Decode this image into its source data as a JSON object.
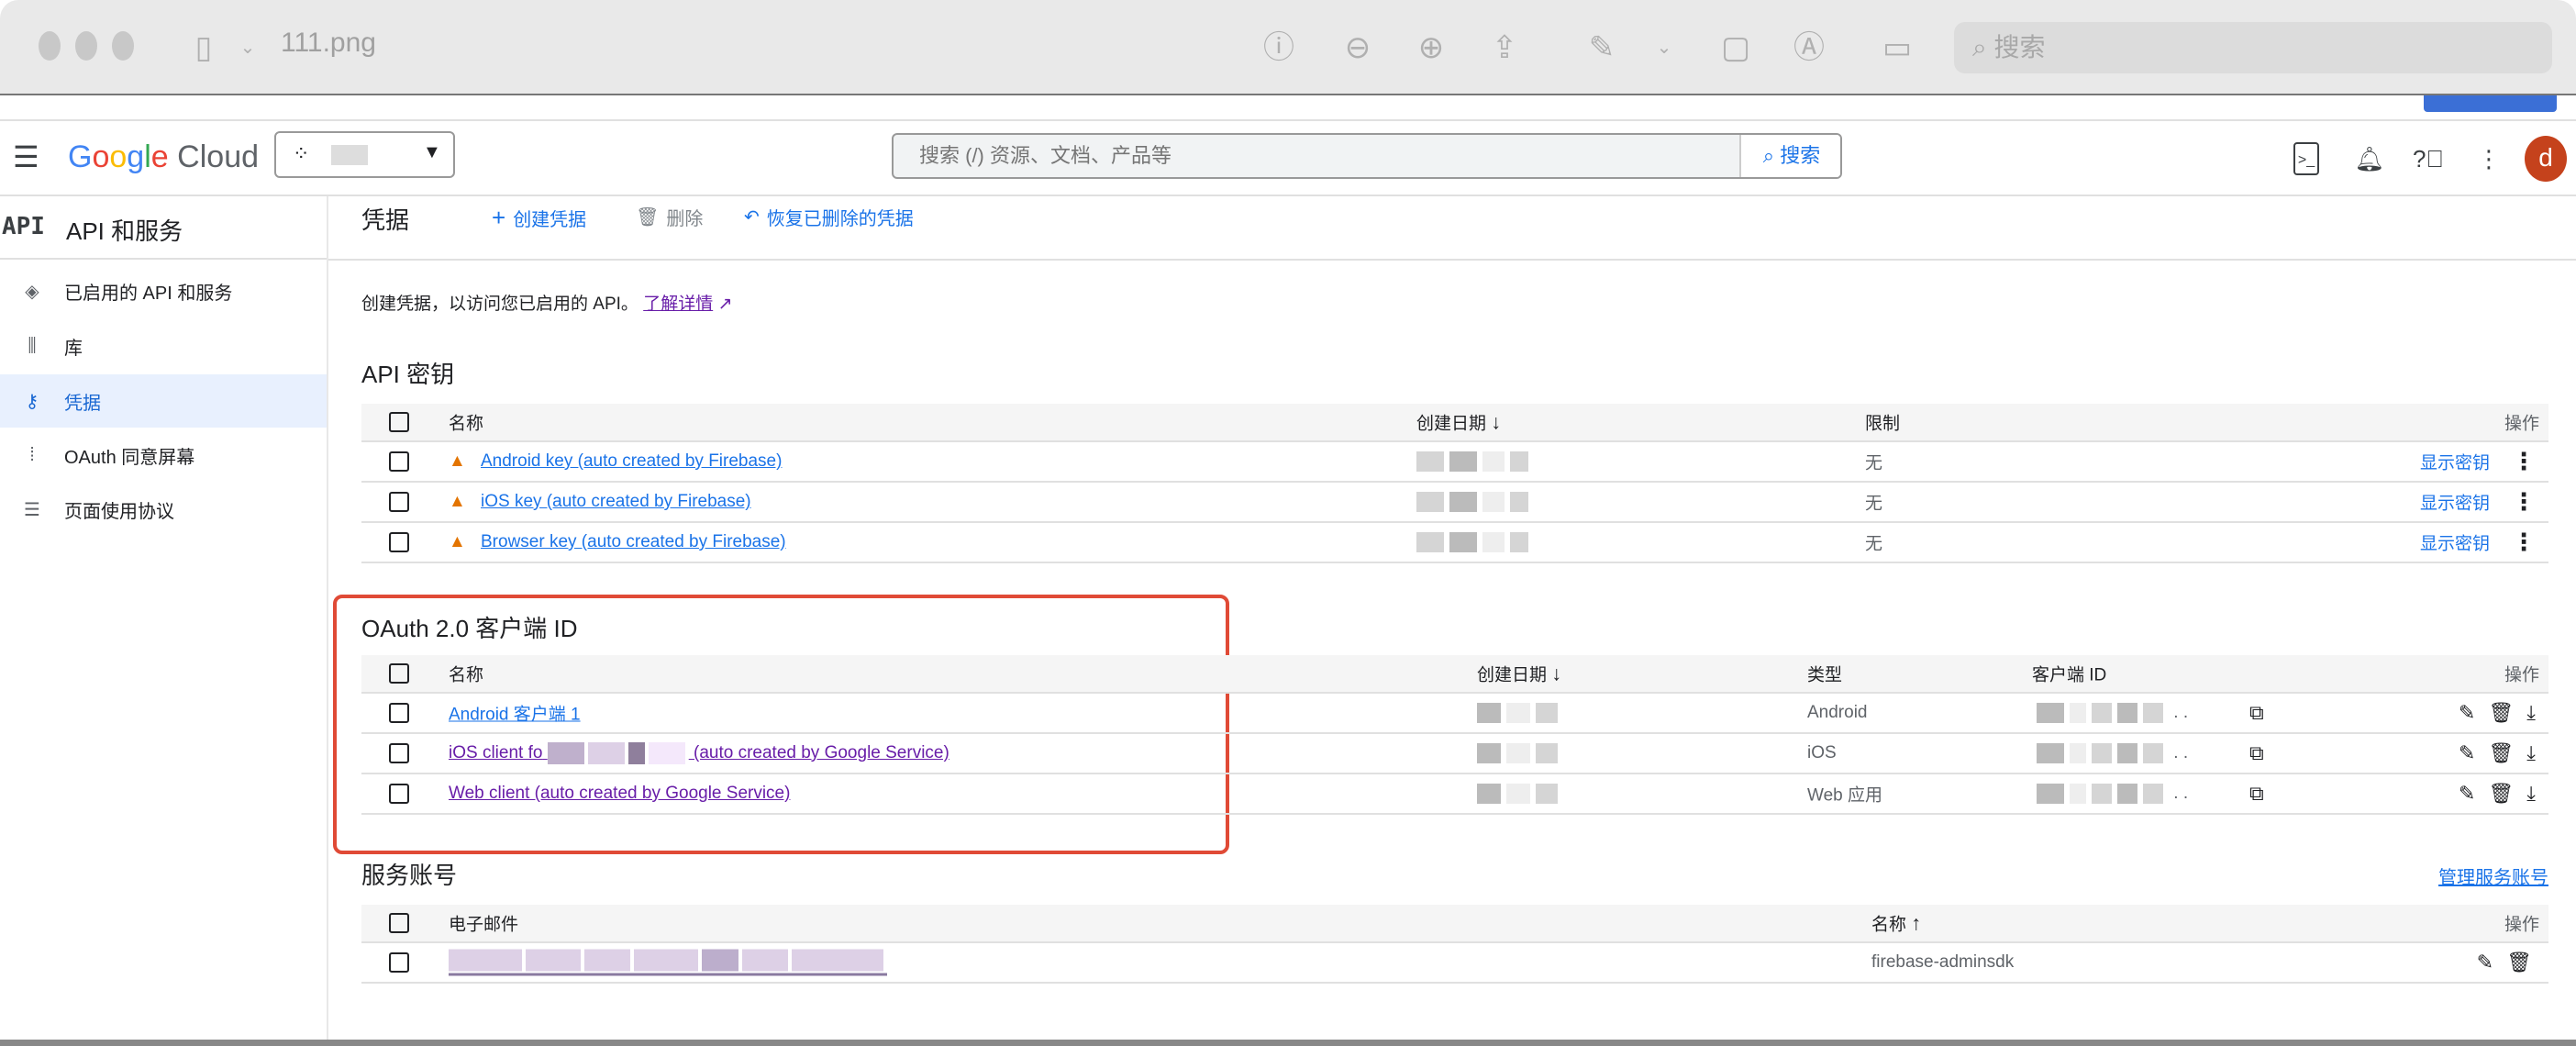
{
  "window": {
    "title": "111.png",
    "search_placeholder": "搜索"
  },
  "header": {
    "brand": "Google Cloud",
    "search_placeholder": "搜索 (/) 资源、文档、产品等",
    "search_button": "搜索",
    "avatar_letter": "d"
  },
  "sidebar": {
    "title": "API 和服务",
    "logo": "API",
    "items": [
      {
        "label": "已启用的 API 和服务",
        "icon": "api-diamond-icon"
      },
      {
        "label": "库",
        "icon": "library-icon"
      },
      {
        "label": "凭据",
        "icon": "key-icon",
        "active": true
      },
      {
        "label": "OAuth 同意屏幕",
        "icon": "consent-icon"
      },
      {
        "label": "页面使用协议",
        "icon": "settings-list-icon"
      }
    ]
  },
  "page": {
    "title": "凭据",
    "create": "创建凭据",
    "delete": "删除",
    "restore": "恢复已删除的凭据",
    "description": "创建凭据，以访问您已启用的 API。",
    "learn_more": "了解详情"
  },
  "api_keys": {
    "heading": "API 密钥",
    "columns": {
      "name": "名称",
      "date": "创建日期",
      "restriction": "限制",
      "actions": "操作"
    },
    "rows": [
      {
        "name": "Android key (auto created by Firebase)",
        "restriction": "无",
        "action": "显示密钥"
      },
      {
        "name": "iOS key (auto created by Firebase)",
        "restriction": "无",
        "action": "显示密钥"
      },
      {
        "name": "Browser key (auto created by Firebase)",
        "restriction": "无",
        "action": "显示密钥"
      }
    ]
  },
  "oauth": {
    "heading": "OAuth 2.0 客户端 ID",
    "columns": {
      "name": "名称",
      "date": "创建日期",
      "type": "类型",
      "client_id": "客户端 ID",
      "actions": "操作"
    },
    "rows": [
      {
        "name": "Android 客户端 1",
        "type": "Android"
      },
      {
        "name_prefix": "iOS client fo",
        "name_suffix": "(auto created by Google Service)",
        "type": "iOS"
      },
      {
        "name": "Web client (auto created by Google Service)",
        "type": "Web 应用"
      }
    ]
  },
  "service_accounts": {
    "heading": "服务账号",
    "manage": "管理服务账号",
    "columns": {
      "email": "电子邮件",
      "name": "名称",
      "actions": "操作"
    },
    "rows": [
      {
        "name": "firebase-adminsdk"
      }
    ]
  },
  "colors": {
    "accent": "#1a73e8",
    "highlight_box": "#e04a36",
    "avatar": "#c5421c",
    "warning": "#e37400"
  }
}
